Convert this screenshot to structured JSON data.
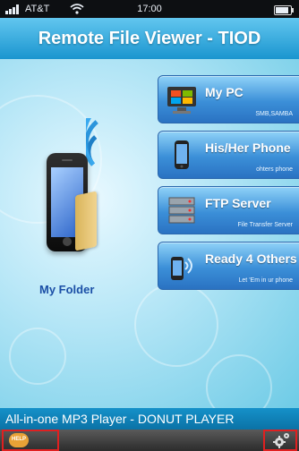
{
  "status_bar": {
    "carrier": "AT&T",
    "time": "17:00",
    "battery_level": 0.85
  },
  "title_bar": {
    "title": "Remote File Viewer - TIOD"
  },
  "main": {
    "my_folder_label": "My Folder",
    "menu": [
      {
        "label": "My PC",
        "sub": "SMB,SAMBA",
        "icon": "windows-pc-icon"
      },
      {
        "label": "His/Her Phone",
        "sub": "ohters phone",
        "icon": "phone-icon"
      },
      {
        "label": "FTP Server",
        "sub": "File Transfer Server",
        "icon": "server-rack-icon"
      },
      {
        "label": "Ready 4 Others",
        "sub": "Let 'Em in ur phone",
        "icon": "phone-signal-icon"
      }
    ]
  },
  "marquee": {
    "text": "All-in-one MP3 Player - DONUT PLAYER"
  },
  "bottom_bar": {
    "help_label": "HELP",
    "help_icon": "help-bubble-icon",
    "settings_icon": "gear-icon"
  },
  "colors": {
    "title_bar": "#1a95cf",
    "accent": "#2a72c2",
    "highlight_border": "#e02020"
  }
}
